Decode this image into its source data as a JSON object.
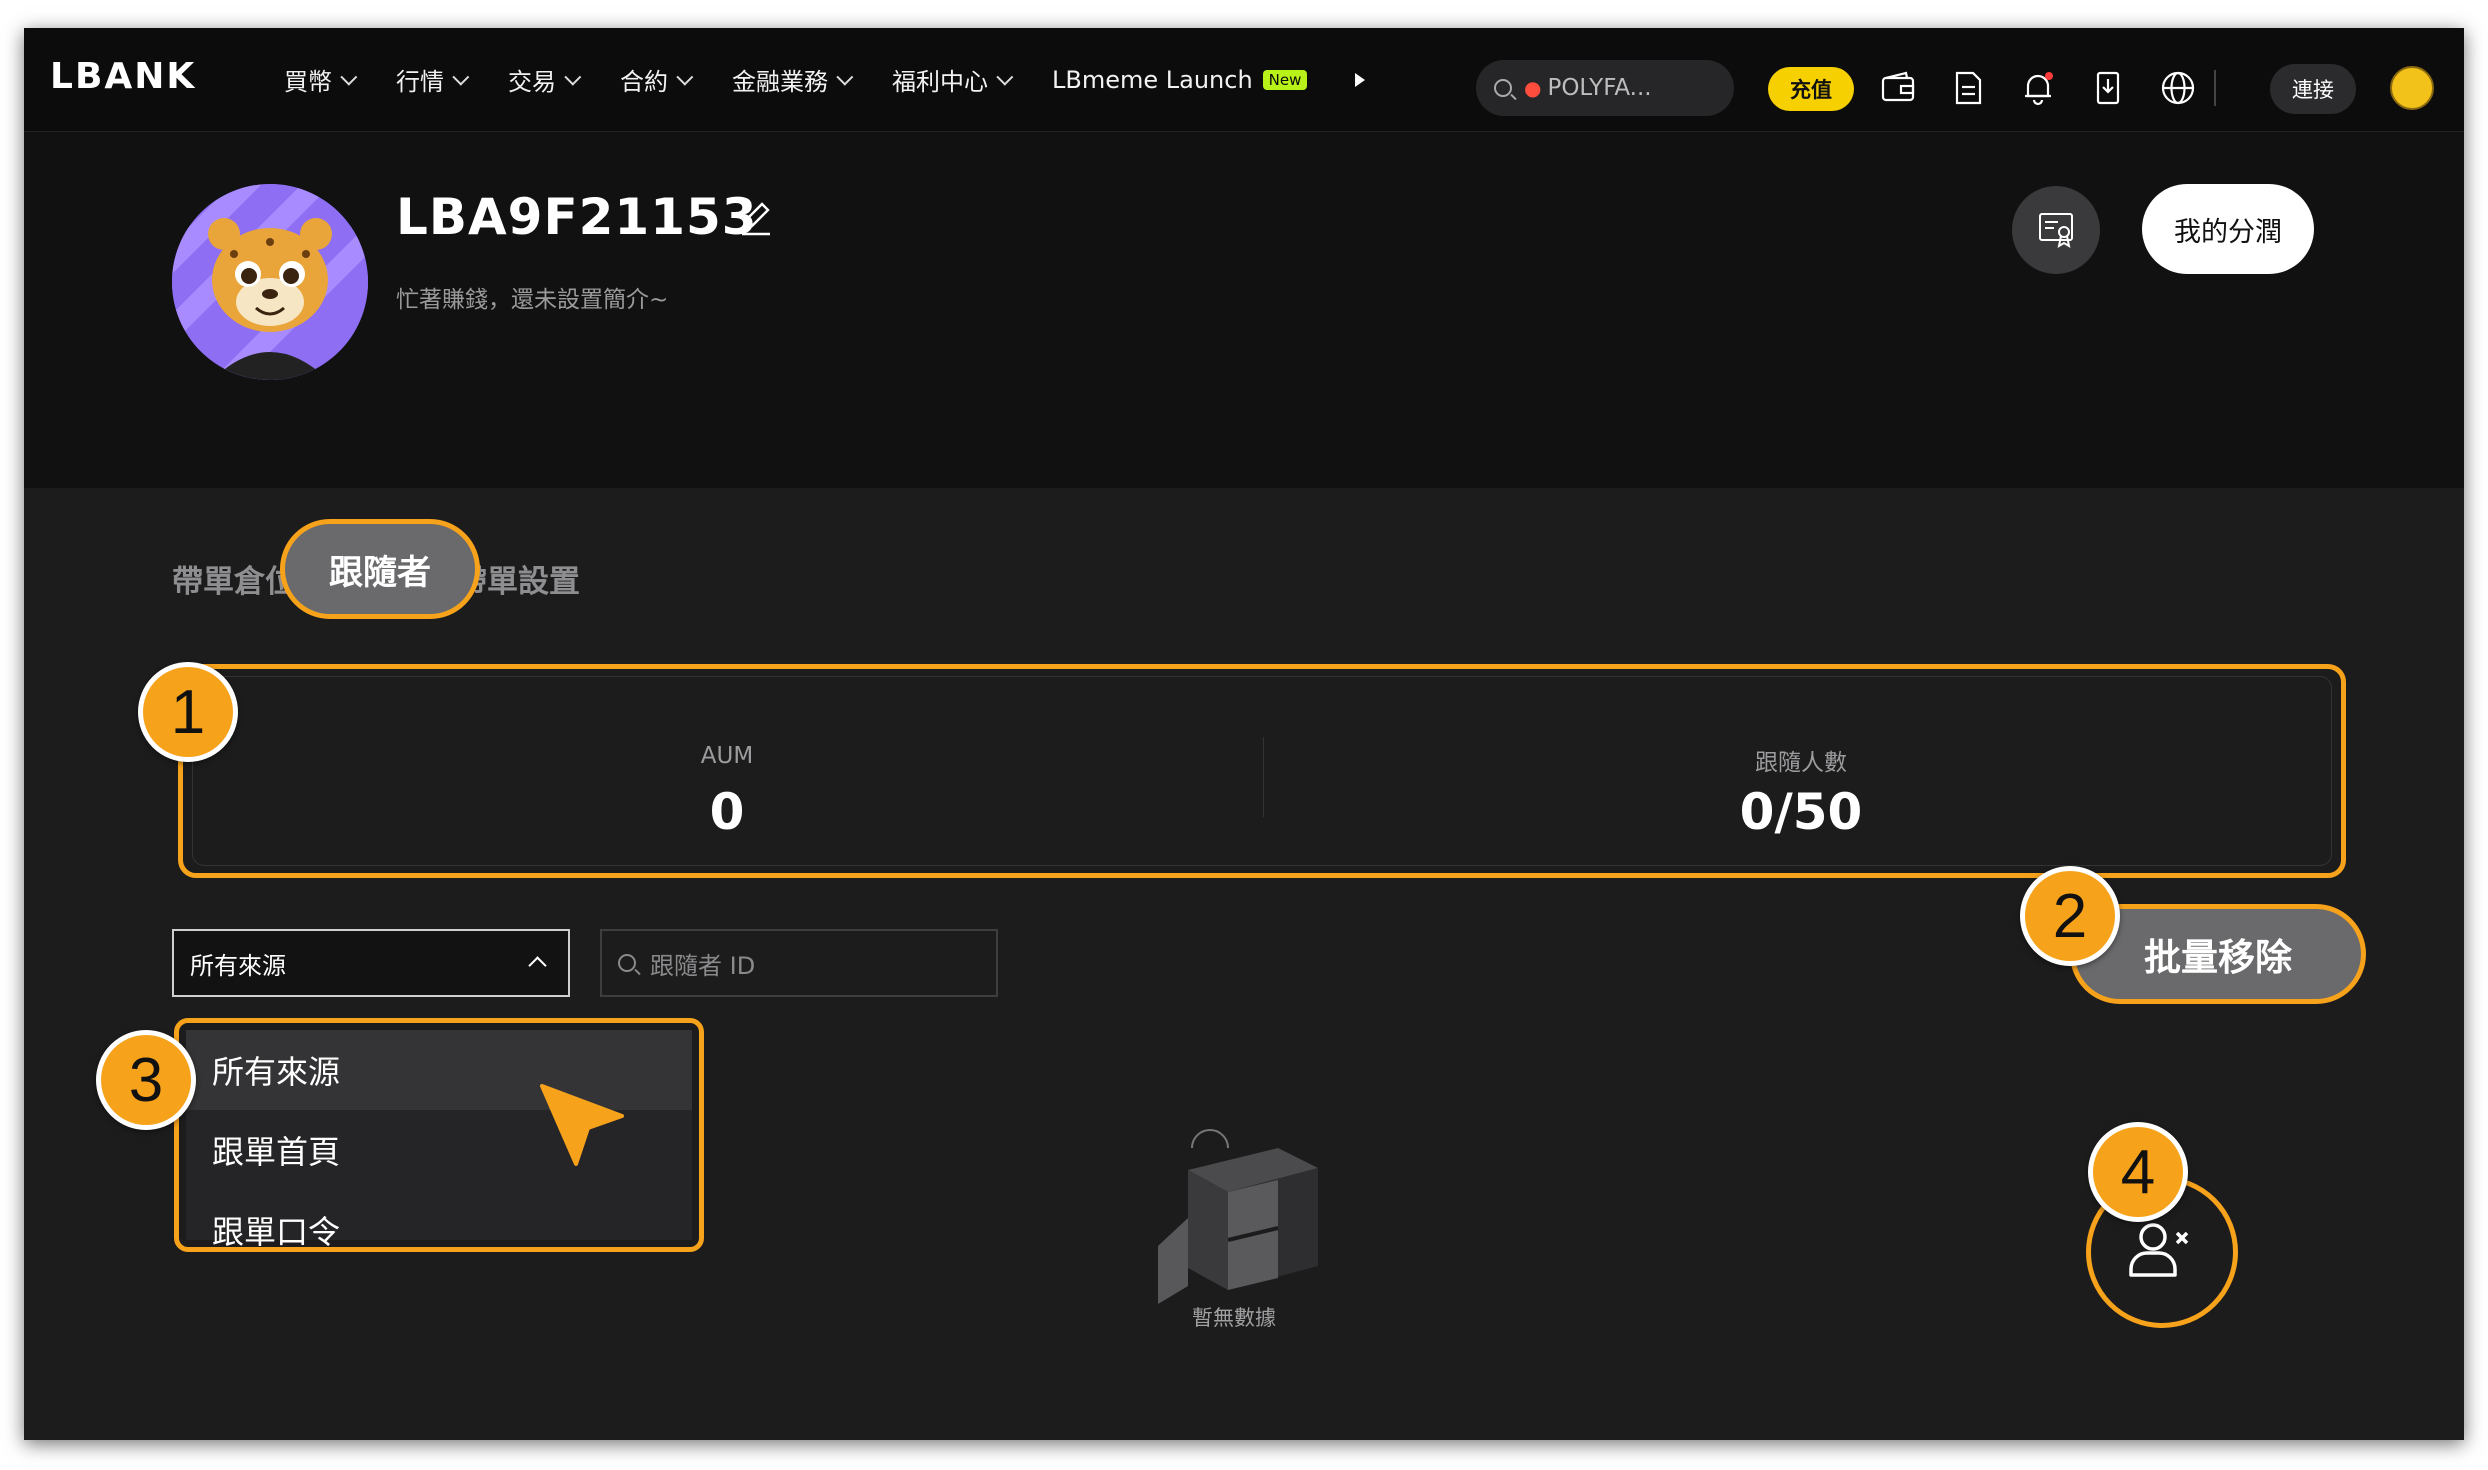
{
  "nav": {
    "logo": "LBANK",
    "items": [
      {
        "label": "買幣",
        "dropdown": true
      },
      {
        "label": "行情",
        "dropdown": true
      },
      {
        "label": "交易",
        "dropdown": true
      },
      {
        "label": "合約",
        "dropdown": true
      },
      {
        "label": "金融業務",
        "dropdown": true
      },
      {
        "label": "福利中心",
        "dropdown": true
      },
      {
        "label": "LBmeme Launch",
        "dropdown": false
      }
    ],
    "new_badge": "New",
    "search_text": "POLYFA...",
    "deposit_label": "充值",
    "connect_label": "連接",
    "icons": [
      "wallet-icon",
      "orders-icon",
      "bell-icon",
      "download-icon",
      "globe-icon"
    ],
    "accent_color": "#f6d000"
  },
  "profile": {
    "username": "LBA9F21153",
    "bio": "忙著賺錢，還未設置簡介~",
    "share_label": "我的分潤"
  },
  "tabs": {
    "tab1": "帶單倉位",
    "active": "跟隨者",
    "tab3": "帶單設置"
  },
  "stats": {
    "aum_label": "AUM",
    "aum_value": "0",
    "followers_label": "跟隨人數",
    "followers_value": "0/50"
  },
  "filters": {
    "source_selected": "所有來源",
    "search_placeholder": "跟隨者 ID",
    "source_options": [
      "所有來源",
      "跟單首頁",
      "跟單口令"
    ]
  },
  "batch_remove_label": "批量移除",
  "empty_text": "暫無數據",
  "markers": [
    "1",
    "2",
    "3",
    "4"
  ],
  "highlight_color": "#f7a21b"
}
